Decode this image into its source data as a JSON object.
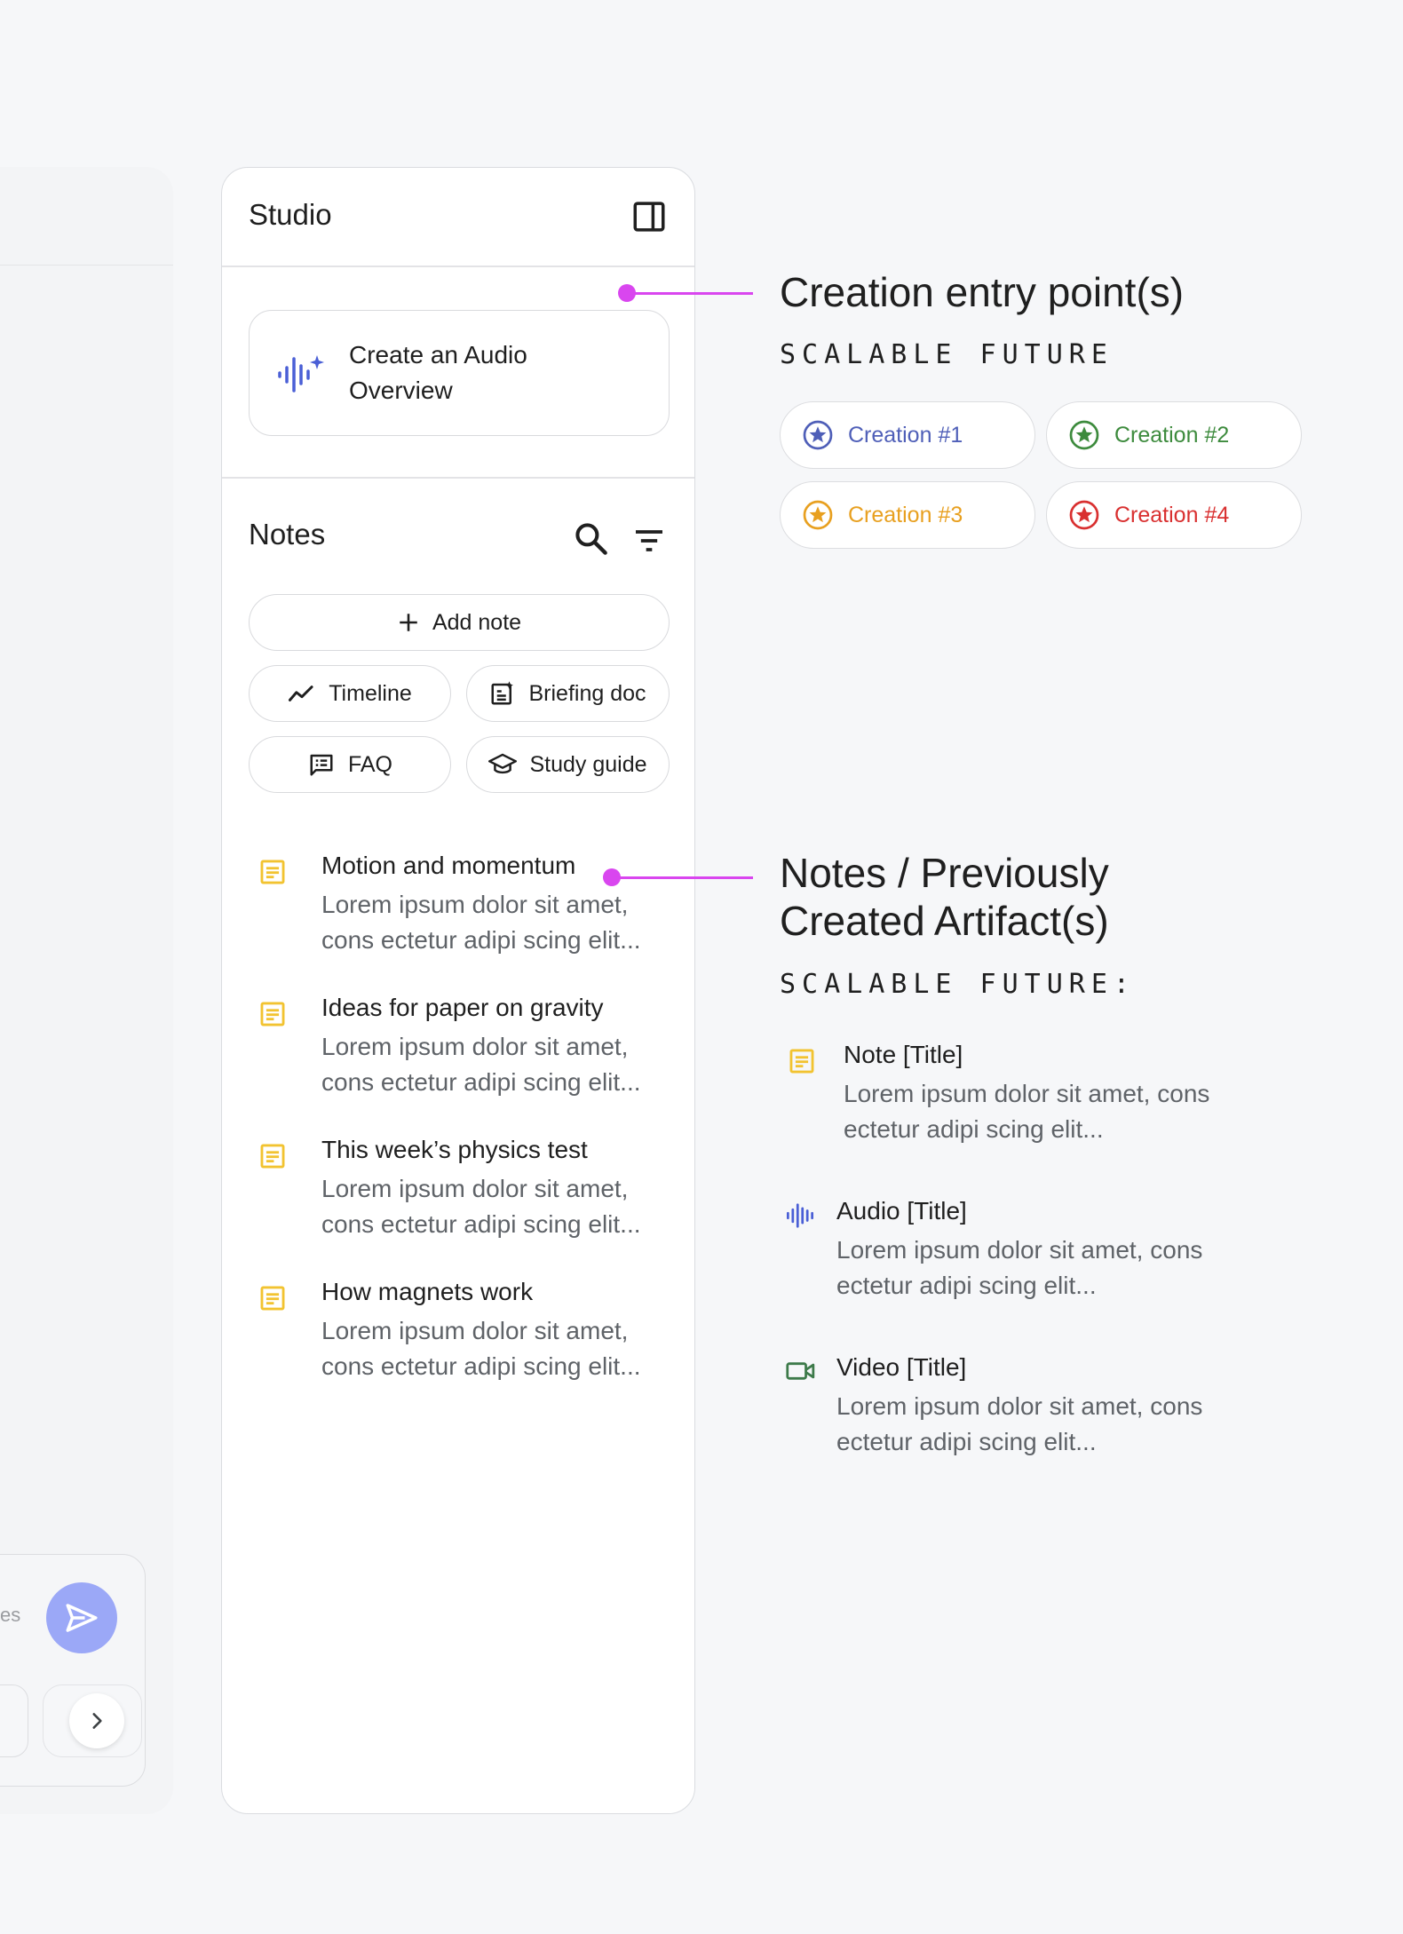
{
  "left_panel": {
    "chat_placeholder_fragment": "es"
  },
  "studio": {
    "title": "Studio",
    "audio_overview_label": "Create an Audio Overview",
    "notes_title": "Notes",
    "add_note_label": "Add note",
    "chips": [
      {
        "label": "Timeline",
        "icon": "timeline-icon"
      },
      {
        "label": "Briefing doc",
        "icon": "briefing-doc-icon"
      },
      {
        "label": "FAQ",
        "icon": "faq-icon"
      },
      {
        "label": "Study guide",
        "icon": "study-guide-icon"
      }
    ],
    "notes": [
      {
        "title": "Motion and momentum",
        "body": "Lorem ipsum dolor sit amet, cons ectetur adipi scing elit..."
      },
      {
        "title": "Ideas for paper on gravity",
        "body": "Lorem ipsum dolor sit amet, cons ectetur adipi scing elit..."
      },
      {
        "title": "This week’s physics test",
        "body": "Lorem ipsum dolor sit amet, cons ectetur adipi scing elit..."
      },
      {
        "title": "How magnets work",
        "body": "Lorem ipsum dolor sit amet, cons ectetur adipi scing elit..."
      }
    ]
  },
  "annotations": {
    "creation": {
      "title": "Creation entry point(s)",
      "subtitle": "SCALABLE FUTURE",
      "items": [
        {
          "label": "Creation #1",
          "color": "#4f5fb8"
        },
        {
          "label": "Creation #2",
          "color": "#3d8b3d"
        },
        {
          "label": "Creation #3",
          "color": "#e8a020"
        },
        {
          "label": "Creation #4",
          "color": "#d93030"
        }
      ]
    },
    "notes": {
      "title_line1": "Notes / Previously",
      "title_line2": "Created Artifact(s)",
      "subtitle": "SCALABLE FUTURE:",
      "items": [
        {
          "title": "Note [Title]",
          "body": "Lorem ipsum dolor sit amet, cons ectetur adipi scing elit...",
          "icon": "note-icon"
        },
        {
          "title": "Audio [Title]",
          "body": "Lorem ipsum dolor sit amet, cons ectetur adipi scing elit...",
          "icon": "audio-icon"
        },
        {
          "title": "Video [Title]",
          "body": "Lorem ipsum dolor sit amet, cons ectetur adipi scing elit...",
          "icon": "video-icon"
        }
      ]
    }
  },
  "colors": {
    "accent_magenta": "#d946ef",
    "note_yellow": "#f2c330",
    "audio_blue": "#4a5fd6",
    "video_green": "#3d7a4a",
    "send_button": "#9ba8f7"
  }
}
